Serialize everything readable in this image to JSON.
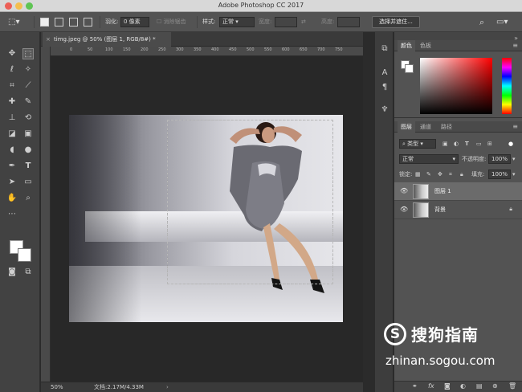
{
  "window": {
    "title": "Adobe Photoshop CC 2017"
  },
  "options": {
    "feather_label": "羽化:",
    "feather_value": "0 像素",
    "anti_alias": "消除锯齿",
    "style_label": "样式:",
    "style_value": "正常",
    "width_label": "宽度:",
    "height_label": "高度:",
    "select_mask_button": "选择并遮住..."
  },
  "document": {
    "tab_title": "timg.jpeg @ 50% (图层 1, RGB/8#) *",
    "tab_close": "×",
    "zoom": "50%",
    "doc_size": "文档:2.17M/4.33M",
    "ruler_numbers": [
      "0",
      "50",
      "100",
      "150",
      "200",
      "250",
      "300",
      "350",
      "400",
      "450",
      "500",
      "550",
      "600",
      "650",
      "700",
      "750"
    ]
  },
  "panels": {
    "color_tab": "颜色",
    "swatches_tab": "色板",
    "layers_tab": "图层",
    "channels_tab": "通道",
    "paths_tab": "路径",
    "kind_filter": "类型",
    "blend_mode": "正常",
    "opacity_label": "不透明度:",
    "opacity_value": "100%",
    "lock_label": "锁定:",
    "fill_label": "填充:",
    "fill_value": "100%",
    "layers": [
      {
        "name": "图层 1",
        "selected": true
      },
      {
        "name": "背景",
        "locked": true
      }
    ]
  },
  "watermark": {
    "logo_letter": "S",
    "brand_cn": "搜狗指南",
    "brand_url": "zhinan.sogou.com"
  },
  "colors": {
    "foreground": "#ffffff",
    "background": "#ffffff"
  }
}
